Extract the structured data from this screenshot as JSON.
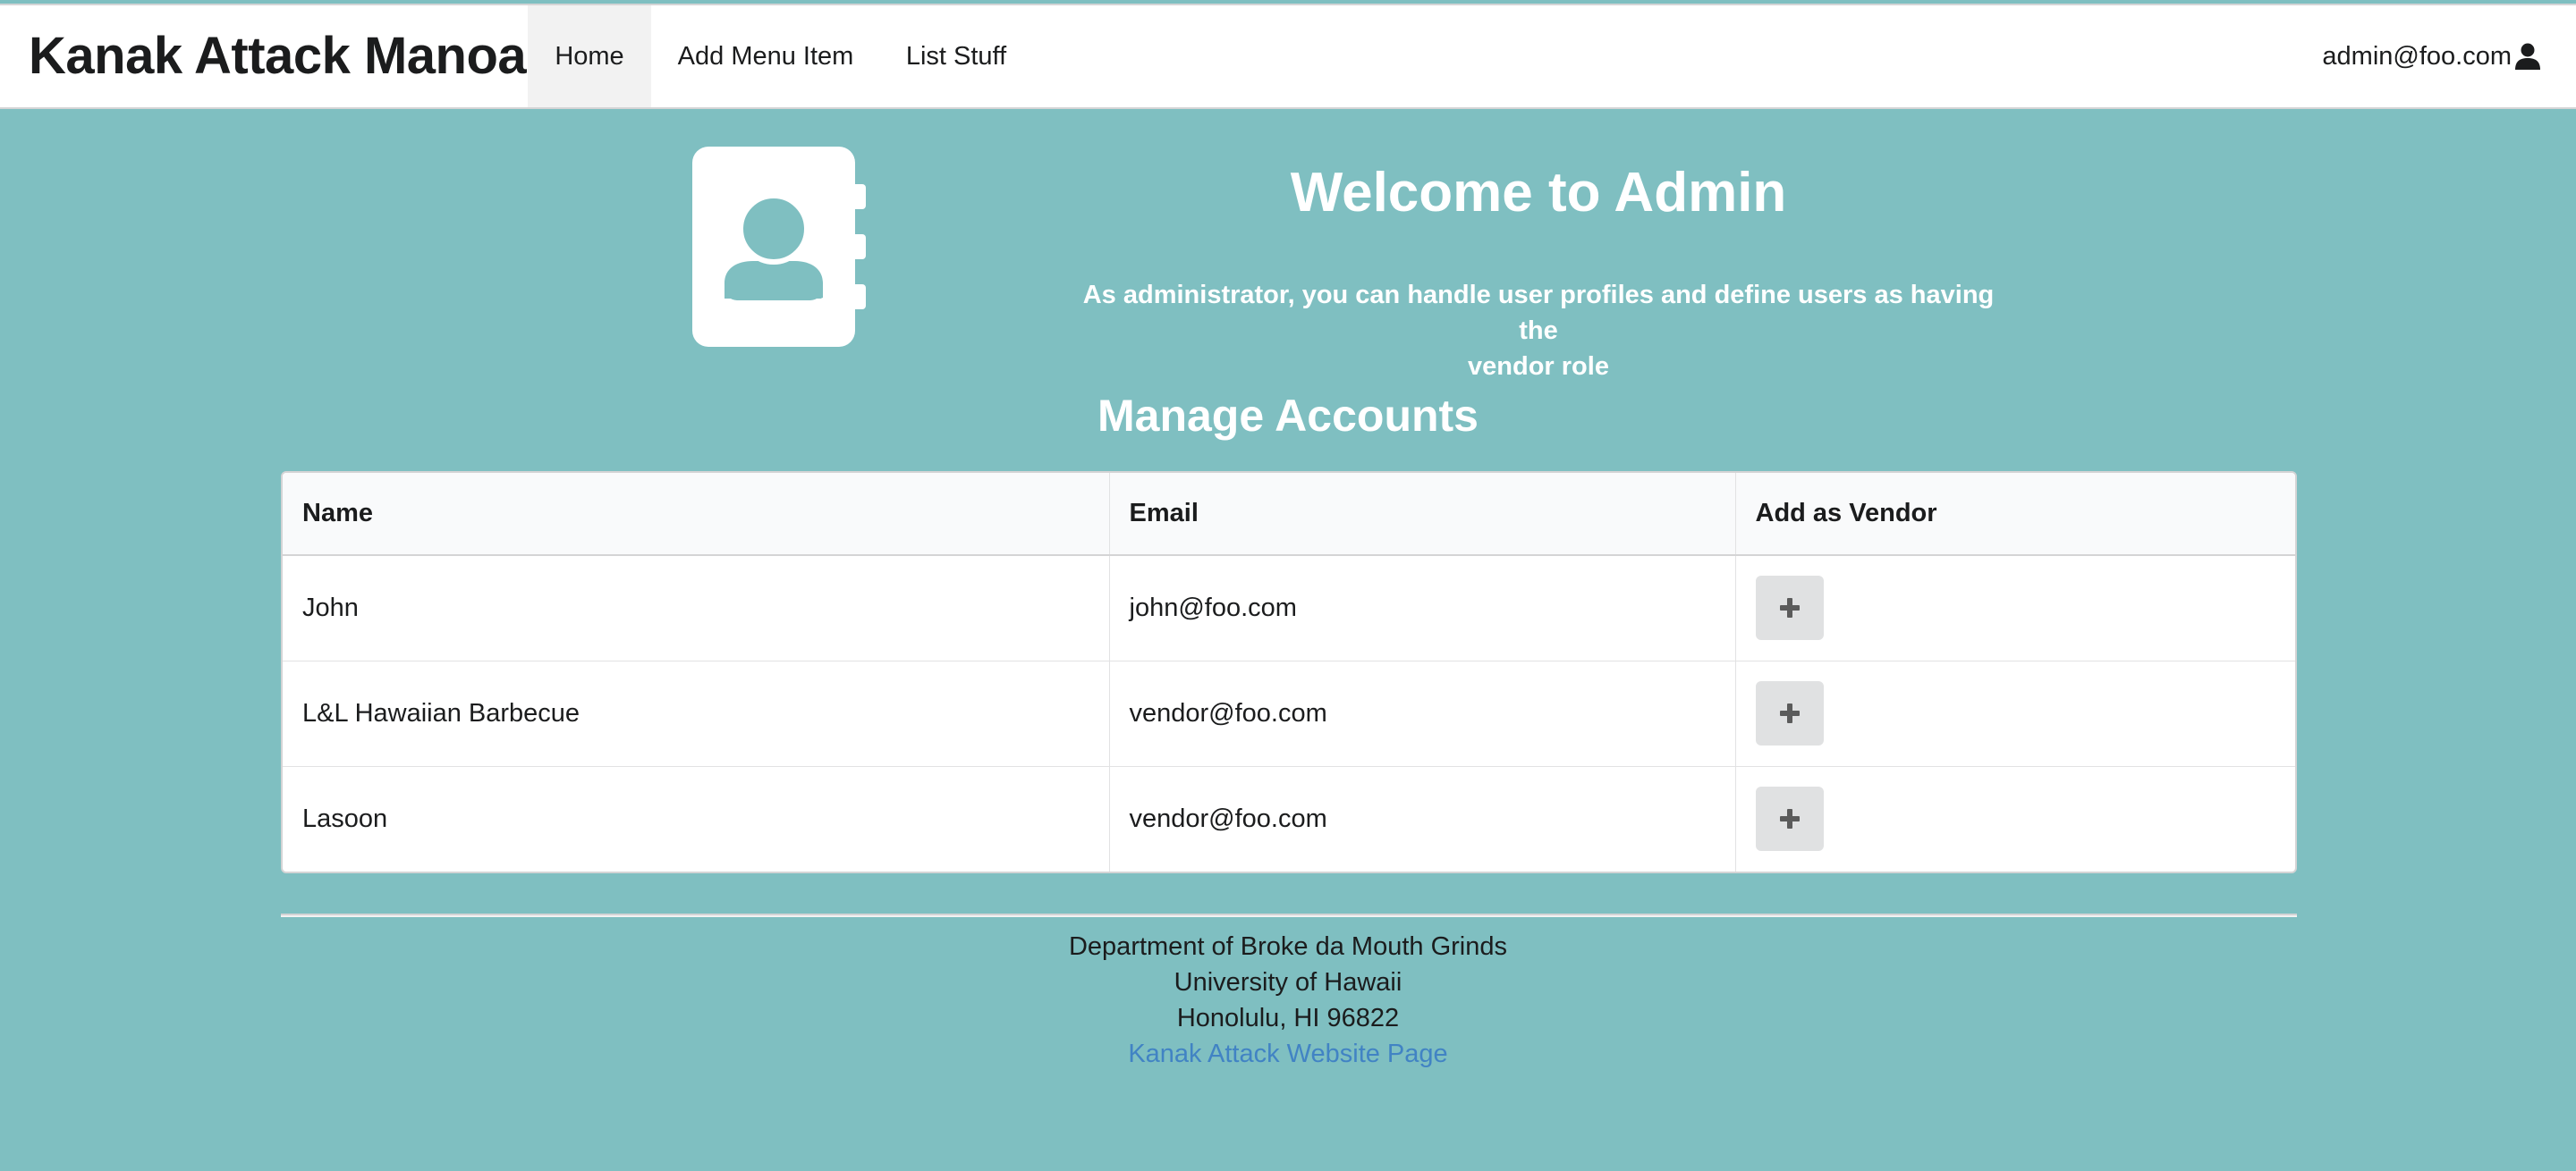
{
  "navbar": {
    "brand": "Kanak Attack Manoa",
    "items": [
      {
        "label": "Home"
      },
      {
        "label": "Add Menu Item"
      },
      {
        "label": "List Stuff"
      }
    ],
    "user": "admin@foo.com",
    "user_icon": "user-icon"
  },
  "hero": {
    "icon": "address-book-icon",
    "title": "Welcome to Admin",
    "subtitle_line1": "As administrator, you can handle user profiles and define users as having the",
    "subtitle_line2": "vendor role"
  },
  "manage": {
    "title": "Manage Accounts",
    "columns": [
      "Name",
      "Email",
      "Add as Vendor"
    ],
    "rows": [
      {
        "name": "John",
        "email": "john@foo.com"
      },
      {
        "name": "L&L Hawaiian Barbecue",
        "email": "vendor@foo.com"
      },
      {
        "name": "Lasoon",
        "email": "vendor@foo.com"
      }
    ],
    "action_icon": "plus-icon"
  },
  "footer": {
    "line1": "Department of Broke da Mouth Grinds",
    "line2": "University of Hawaii",
    "line3": "Honolulu, HI 96822",
    "link": "Kanak Attack Website Page"
  },
  "colors": {
    "background": "#7fbfc1",
    "navbar": "#ffffff",
    "active_nav": "#f2f2f2",
    "link": "#4183c4",
    "button": "#e0e1e2"
  }
}
